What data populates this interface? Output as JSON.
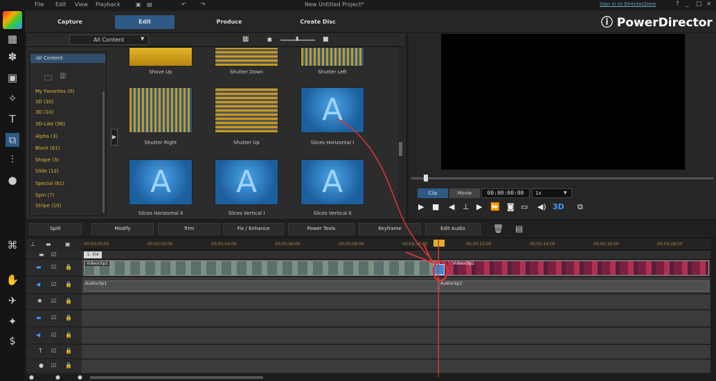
{
  "menu": {
    "file": "File",
    "edit": "Edit",
    "view": "View",
    "playback": "Playback"
  },
  "window": {
    "title": "New Untitled Project*",
    "signin": "Sign in to DirectorZone",
    "help": "?",
    "minimize": "_",
    "maximize": "□",
    "close": "×"
  },
  "tabs": {
    "capture": "Capture",
    "edit": "Edit",
    "produce": "Produce",
    "create_disc": "Create Disc"
  },
  "brand": "ⓘ PowerDirector",
  "library": {
    "filter_value": "All Content",
    "categories_header": "All Content",
    "categories": [
      "My Favorites (0)",
      "3D (30)",
      "3D (10)",
      "3D-Like (36)",
      "Alpha (3)",
      "Block (61)",
      "Shape (3)",
      "Slide (12)",
      "Special (81)",
      "Spin (7)",
      "Stripe (10)"
    ],
    "transitions": [
      {
        "name": "Shove Up"
      },
      {
        "name": "Shutter Down"
      },
      {
        "name": "Shutter Left"
      },
      {
        "name": "Shutter Right"
      },
      {
        "name": "Shutter Up"
      },
      {
        "name": "Slices Horizontal I"
      },
      {
        "name": "Slices Horizontal II"
      },
      {
        "name": "Slices Vertical I"
      },
      {
        "name": "Slices Vertical II"
      }
    ]
  },
  "preview": {
    "clip_label": "Clip",
    "movie_label": "Movie",
    "timecode": "00:00:00:00",
    "speed": "1x",
    "depth_3d": "3D"
  },
  "function_bar": {
    "split": "Split",
    "modify": "Modify",
    "trim": "Trim",
    "fix_enhance": "Fix / Enhance",
    "power_tools": "Power Tools",
    "keyframe": "Keyframe",
    "edit_audio": "Edit Audio"
  },
  "timeline": {
    "marker_label": "1. Vid",
    "ruler_ticks": [
      "00;00;00;00",
      "00;00;02;00",
      "00;00;04;00",
      "00;00;06;00",
      "00;00;08;00",
      "00;00;10;00",
      "00;00;12;00",
      "00;00;14;00",
      "00;00;16;00",
      "00;00;18;00"
    ],
    "video_clip1": "Videoclip1",
    "video_clip2": "Videoclip2",
    "audio_clip1": "Audioclip1",
    "audio_clip2": "Audioclip2"
  },
  "colors": {
    "accent": "#2f5a85",
    "category_text": "#e0b83a",
    "annotation": "#d33"
  }
}
